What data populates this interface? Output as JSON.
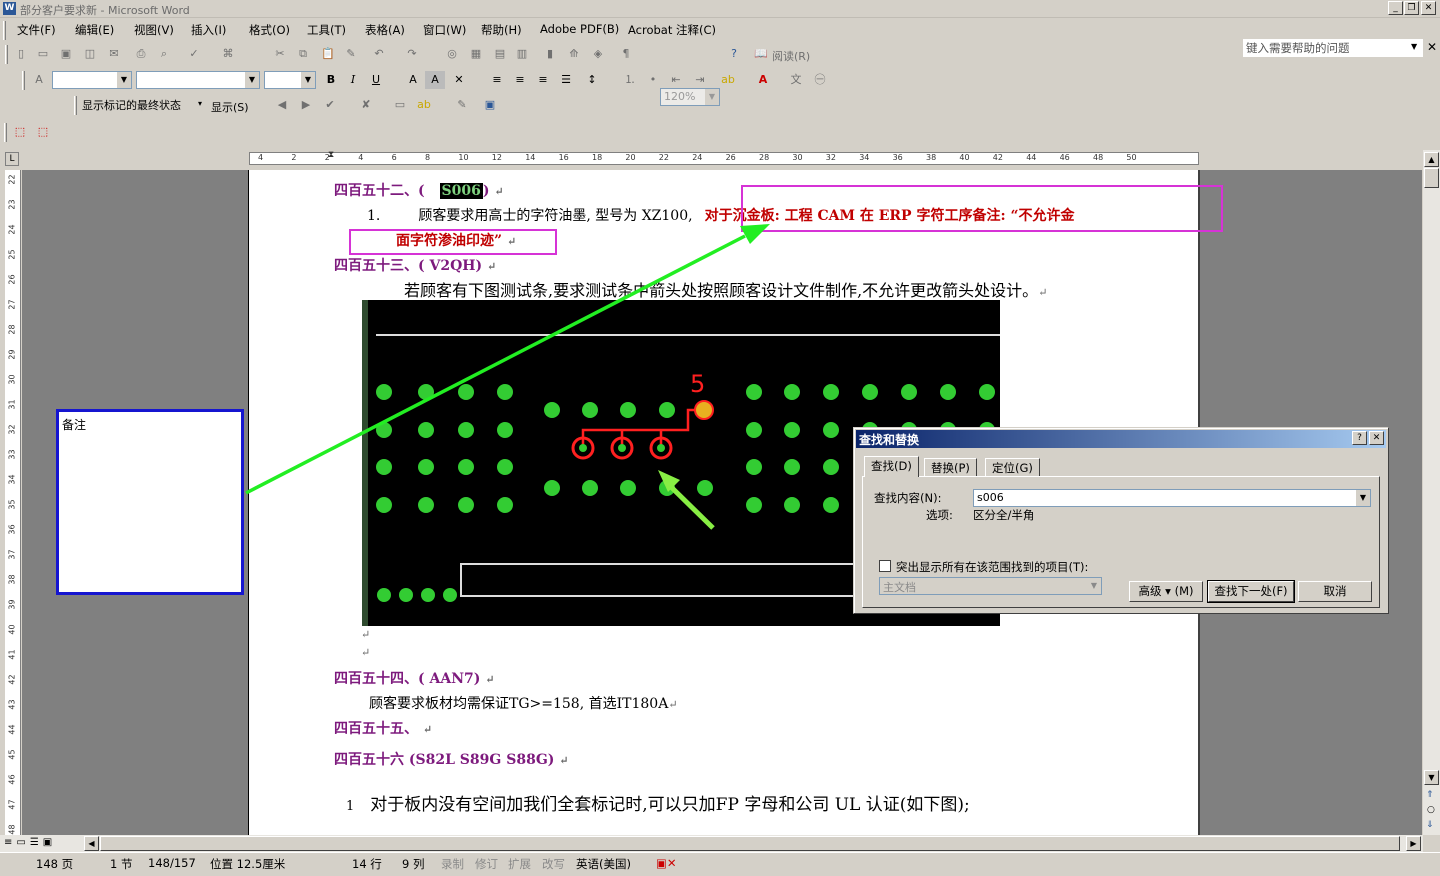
{
  "window": {
    "title": "部分客户要求新 - Microsoft Word",
    "help_placeholder": "键入需要帮助的问题"
  },
  "menu": [
    "文件(F)",
    "编辑(E)",
    "视图(V)",
    "插入(I)",
    "格式(O)",
    "工具(T)",
    "表格(A)",
    "窗口(W)",
    "帮助(H)",
    "Adobe PDF(B)",
    "Acrobat 注释(C)"
  ],
  "toolbar": {
    "zoom": "120%",
    "read_label": "阅读(R)",
    "markup_state": "显示标记的最终状态",
    "show_label": "显示(S)"
  },
  "ruler": {
    "h_labels": [
      "4",
      "2",
      "2",
      "4",
      "6",
      "8",
      "10",
      "12",
      "14",
      "16",
      "18",
      "20",
      "22",
      "24",
      "26",
      "28",
      "30",
      "32",
      "34",
      "36",
      "38",
      "40",
      "42",
      "44",
      "46",
      "48",
      "50"
    ],
    "v_labels": [
      "22",
      "23",
      "24",
      "25",
      "26",
      "27",
      "28",
      "29",
      "30",
      "31",
      "32",
      "33",
      "34",
      "35",
      "36",
      "37",
      "38",
      "39",
      "40",
      "41",
      "42",
      "43",
      "44",
      "45",
      "46",
      "47",
      "48"
    ]
  },
  "doc": {
    "h452_prefix": "四百五十二、(",
    "h452_code": "S006",
    "h452_suffix": ")",
    "item1_num": "1.",
    "item1_text": "顾客要求用高士的字符油墨, 型号为 XZ100,",
    "item1_red1": "对于沉金板: 工程 CAM 在 ERP 字符工序备注: “不允许金",
    "item1_red2": "面字符渗油印迹”",
    "h453": "四百五十三、(   V2QH)",
    "p453": "若顾客有下图测试条,要求测试条中箭头处按照顾客设计文件制作,不允许更改箭头处设计。",
    "h454": "四百五十四、(   AAN7)",
    "p454": "顾客要求板材均需保证TG>=158, 首选IT180A",
    "h455": "四百五十五、",
    "h456": "四百五十六 (S82L S89G S88G)",
    "p456_num": "1",
    "p456": "对于板内没有空间加我们全套标记时,可以只加FP 字母和公司 UL 认证(如下图);",
    "pcb_label": "5"
  },
  "comment": {
    "label": "备注"
  },
  "dialog": {
    "title": "查找和替换",
    "tabs": [
      "查找(D)",
      "替换(P)",
      "定位(G)"
    ],
    "find_label": "查找内容(N):",
    "find_value": "s006",
    "options_label": "选项:",
    "options_value": "区分全/半角",
    "highlight_label": "突出显示所有在该范围找到的项目(T):",
    "scope_value": "主文档",
    "advanced_btn": "高级 ▾ (M)",
    "findnext_btn": "查找下一处(F)",
    "cancel_btn": "取消"
  },
  "status": {
    "page": "148 页",
    "section": "1 节",
    "pages": "148/157",
    "position": "位置 12.5厘米",
    "line": "14 行",
    "col": "9 列",
    "rec": "录制",
    "trk": "修订",
    "ext": "扩展",
    "ovr": "改写",
    "lang": "英语(美国)"
  },
  "colors": {
    "heading": "#7d1a7d",
    "red_note": "#c00000",
    "magenta_box": "#d633d6",
    "arrow_green": "#22ee22",
    "pcb_pad": "#33cc33"
  }
}
